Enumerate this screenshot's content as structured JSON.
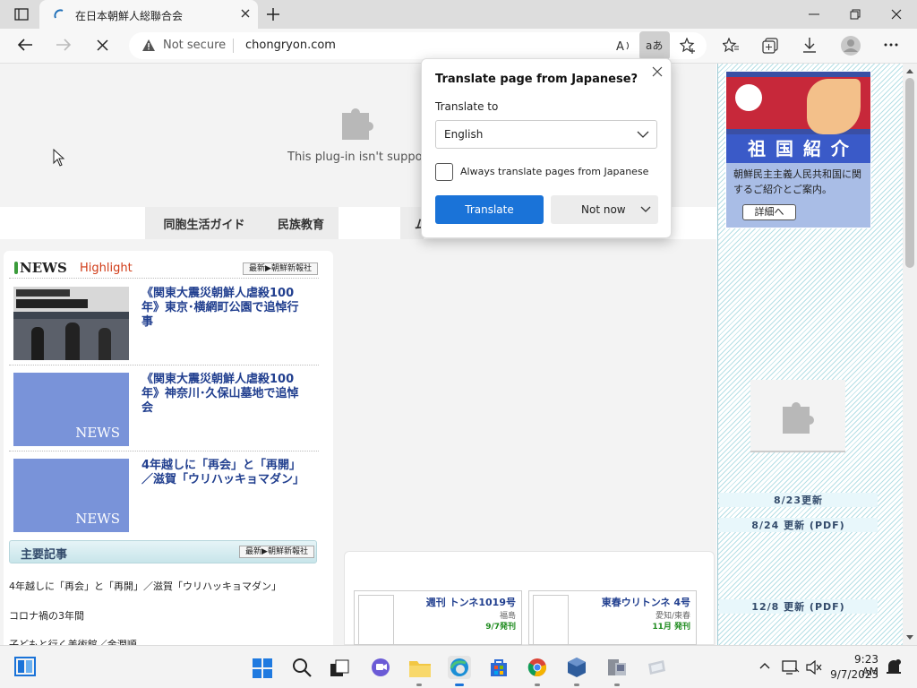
{
  "browser": {
    "tab_title": "在日本朝鮮人総聯合会",
    "not_secure": "Not secure",
    "url": "chongryon.com"
  },
  "page": {
    "plugin_message": "This plug-in isn't supporte",
    "nav": [
      "同胞生活ガイド",
      "民族教育",
      "ム"
    ],
    "news_logo": "NEWS",
    "news_highlight": "Highlight",
    "latest_link": "最新▶朝鮮新報社",
    "news_items": [
      {
        "text": "《関東大震災朝鮮人虐殺100年》東京･横網町公園で追悼行事",
        "thumb": ""
      },
      {
        "text": "《関東大震災朝鮮人虐殺100年》神奈川･久保山墓地で追悼会",
        "thumb": "NEWS"
      },
      {
        "text": "4年越しに「再会」と「再開」／滋賀「ウリハッキョマダン」",
        "thumb": "NEWS"
      }
    ],
    "main_articles_title": "主要記事",
    "main_articles_link": "最新▶朝鮮新報社",
    "articles": [
      "4年越しに「再会」と「再開」／滋賀「ウリハッキョマダン」",
      "コロナ禍の3年間",
      "子どもと行く美術館／金潤順"
    ],
    "magazines": [
      {
        "title": "週刊 トンネ1019号",
        "region": "福島",
        "date": "9/7発刊"
      },
      {
        "title": "東春ウリトンネ 4号",
        "region": "愛知/東春",
        "date": "11月 発刊"
      }
    ],
    "banner": {
      "title": "祖 国 紹 介",
      "desc": "朝鮮民主主義人民共和国に関するご紹介とご案内。",
      "button": "詳細へ"
    },
    "updates": [
      "8/23更新",
      "8/24 更新 (PDF)",
      "12/8 更新 (PDF)"
    ]
  },
  "translate_popup": {
    "title": "Translate page from Japanese?",
    "label": "Translate to",
    "language": "English",
    "checkbox_label": "Always translate pages from Japanese",
    "translate_button": "Translate",
    "not_now_button": "Not now"
  },
  "taskbar": {
    "time": "9:23 AM",
    "date": "9/7/2023"
  },
  "colors": {
    "accent": "#1a73d8",
    "link_blue": "#213f8f",
    "news_red": "#d03a16",
    "thumb_blue": "#7993d9"
  }
}
